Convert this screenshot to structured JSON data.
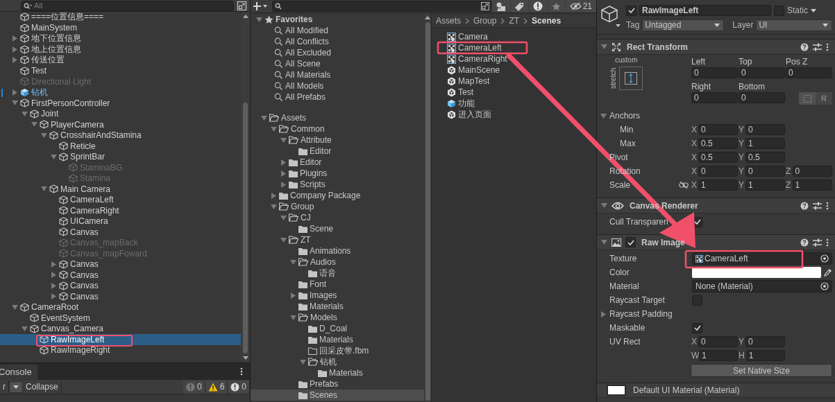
{
  "hierarchy": {
    "search": {
      "placeholder": "All"
    },
    "items": [
      {
        "name": "====位置信息====",
        "kind": "object",
        "active": true,
        "selected": false
      },
      {
        "name": "MainSystem",
        "kind": "object",
        "active": true,
        "selected": false
      },
      {
        "name": "地下位置信息",
        "kind": "object",
        "active": true,
        "selected": false,
        "expanded": false
      },
      {
        "name": "地上位置信息",
        "kind": "object",
        "active": true,
        "selected": false,
        "expanded": false
      },
      {
        "name": "传送位置",
        "kind": "object",
        "active": true,
        "selected": false,
        "expanded": false
      },
      {
        "name": "Test",
        "kind": "object",
        "active": true,
        "selected": false
      },
      {
        "name": "Directional Light",
        "kind": "object",
        "active": false,
        "selected": false
      },
      {
        "name": "钻机",
        "kind": "prefab",
        "active": true,
        "selected": false,
        "expanded": false
      },
      {
        "name": "FirstPersonController",
        "kind": "object",
        "active": true,
        "selected": false,
        "expanded": true,
        "children": [
          {
            "name": "Joint",
            "kind": "object",
            "active": true,
            "selected": false,
            "expanded": true,
            "children": [
              {
                "name": "PlayerCamera",
                "kind": "object",
                "active": true,
                "selected": false,
                "expanded": true,
                "children": [
                  {
                    "name": "CrosshairAndStamina",
                    "kind": "object",
                    "active": true,
                    "selected": false,
                    "expanded": true,
                    "children": [
                      {
                        "name": "Reticle",
                        "kind": "object",
                        "active": true,
                        "selected": false
                      },
                      {
                        "name": "SprintBar",
                        "kind": "object",
                        "active": true,
                        "selected": false,
                        "expanded": true,
                        "children": [
                          {
                            "name": "StaminaBG",
                            "kind": "object",
                            "active": false,
                            "selected": false
                          },
                          {
                            "name": "Stamina",
                            "kind": "object",
                            "active": false,
                            "selected": false
                          }
                        ]
                      }
                    ]
                  },
                  {
                    "name": "Main Camera",
                    "kind": "object",
                    "active": true,
                    "selected": false,
                    "expanded": true,
                    "children": [
                      {
                        "name": "CameraLeft",
                        "kind": "object",
                        "active": true,
                        "selected": false
                      },
                      {
                        "name": "CameraRight",
                        "kind": "object",
                        "active": true,
                        "selected": false
                      },
                      {
                        "name": "UICamera",
                        "kind": "object",
                        "active": true,
                        "selected": false
                      },
                      {
                        "name": "Canvas",
                        "kind": "object",
                        "active": true,
                        "selected": false
                      },
                      {
                        "name": "Canvas_mapBack",
                        "kind": "object",
                        "active": false,
                        "selected": false
                      },
                      {
                        "name": "Canvas_mapFoward",
                        "kind": "object",
                        "active": false,
                        "selected": false
                      },
                      {
                        "name": "Canvas",
                        "kind": "object",
                        "active": true,
                        "selected": false,
                        "expanded": false
                      },
                      {
                        "name": "Canvas",
                        "kind": "object",
                        "active": true,
                        "selected": false,
                        "expanded": false
                      },
                      {
                        "name": "Canvas",
                        "kind": "object",
                        "active": true,
                        "selected": false,
                        "expanded": false
                      },
                      {
                        "name": "Canvas",
                        "kind": "object",
                        "active": true,
                        "selected": false,
                        "expanded": false
                      }
                    ]
                  }
                ]
              }
            ]
          }
        ]
      },
      {
        "name": "CameraRoot",
        "kind": "object",
        "active": true,
        "selected": false,
        "expanded": true,
        "children": [
          {
            "name": "EventSystem",
            "kind": "object",
            "active": true,
            "selected": false
          },
          {
            "name": "Canvas_Camera",
            "kind": "object",
            "active": true,
            "selected": false,
            "expanded": true,
            "children": [
              {
                "name": "RawImageLeft",
                "kind": "object",
                "active": true,
                "selected": true
              },
              {
                "name": "RawImageRight",
                "kind": "object",
                "active": true,
                "selected": false
              }
            ]
          }
        ]
      }
    ]
  },
  "console": {
    "tab": "Console",
    "clear_tail": "r",
    "collapse": "Collapse",
    "infos": "0",
    "warnings": "6",
    "errors": "0"
  },
  "project": {
    "hidden_count": "21",
    "favorites": {
      "label": "Favorites",
      "expanded": true,
      "items": [
        "All Modified",
        "All Conflicts",
        "All Excluded",
        "All Scene",
        "All Materials",
        "All Models",
        "All Prefabs"
      ]
    },
    "tree": [
      {
        "name": "Assets",
        "selected": false,
        "expanded": true,
        "children": [
          {
            "name": "Common",
            "selected": false,
            "expanded": true,
            "children": [
              {
                "name": "Attribute",
                "selected": false,
                "expanded": true,
                "children": [
                  {
                    "name": "Editor",
                    "selected": false
                  }
                ]
              },
              {
                "name": "Editor",
                "selected": false,
                "expanded": false
              },
              {
                "name": "Plugins",
                "selected": false,
                "expanded": false
              },
              {
                "name": "Scripts",
                "selected": false,
                "expanded": false
              }
            ]
          },
          {
            "name": "Company Package",
            "selected": false,
            "expanded": false
          },
          {
            "name": "Group",
            "selected": false,
            "expanded": true,
            "children": [
              {
                "name": "CJ",
                "selected": false,
                "expanded": true,
                "children": [
                  {
                    "name": "Scene",
                    "selected": false
                  }
                ]
              },
              {
                "name": "ZT",
                "selected": false,
                "expanded": true,
                "children": [
                  {
                    "name": "Animations",
                    "selected": false
                  },
                  {
                    "name": "Audios",
                    "selected": false,
                    "expanded": true,
                    "children": [
                      {
                        "name": "语音",
                        "selected": false
                      }
                    ]
                  },
                  {
                    "name": "Font",
                    "selected": false
                  },
                  {
                    "name": "Images",
                    "selected": false,
                    "expanded": false
                  },
                  {
                    "name": "Materials",
                    "selected": false
                  },
                  {
                    "name": "Models",
                    "selected": false,
                    "expanded": true,
                    "children": [
                      {
                        "name": "D_Coal",
                        "selected": false
                      },
                      {
                        "name": "Materials",
                        "selected": false
                      },
                      {
                        "name": "回采皮带.fbm",
                        "selected": false,
                        "empty": true
                      },
                      {
                        "name": "钻机",
                        "selected": false,
                        "expanded": true,
                        "children": [
                          {
                            "name": "Materials",
                            "selected": false
                          }
                        ]
                      }
                    ]
                  },
                  {
                    "name": "Prefabs",
                    "selected": false
                  },
                  {
                    "name": "Scenes",
                    "selected": true
                  }
                ]
              }
            ]
          }
        ]
      }
    ],
    "breadcrumb": [
      "Assets",
      "Group",
      "ZT",
      "Scenes"
    ],
    "files": [
      {
        "name": "Camera",
        "kind": "render_texture"
      },
      {
        "name": "CameraLeft",
        "kind": "render_texture"
      },
      {
        "name": "CameraRight",
        "kind": "render_texture"
      },
      {
        "name": "MainScene",
        "kind": "scene"
      },
      {
        "name": "MapTest",
        "kind": "scene"
      },
      {
        "name": "Test",
        "kind": "scene"
      },
      {
        "name": "功能",
        "kind": "prefab"
      },
      {
        "name": "进入页面",
        "kind": "scene"
      }
    ]
  },
  "inspector": {
    "active": true,
    "name": "RawImageLeft",
    "static": false,
    "static_label": "Static",
    "tag_label": "Tag",
    "tag": "Untagged",
    "layer_label": "Layer",
    "layer": "UI",
    "components": [
      {
        "kind": "rect_transform",
        "title": "Rect Transform",
        "expanded": true,
        "preset": "custom",
        "preset_axis": "stretch",
        "fields": [
          {
            "label": "Left",
            "value": "0"
          },
          {
            "label": "Top",
            "value": "0"
          },
          {
            "label": "Pos Z",
            "value": "0"
          },
          {
            "label": "Right",
            "value": "0"
          },
          {
            "label": "Bottom",
            "value": "0"
          }
        ],
        "raw_edit_button": "R",
        "rows": [
          {
            "kind": "foldout",
            "label": "Anchors",
            "expanded": true,
            "children": [
              {
                "kind": "vector",
                "label": "Min",
                "axes": [
                  {
                    "axis": "X",
                    "value": "0"
                  },
                  {
                    "axis": "Y",
                    "value": "0"
                  }
                ]
              },
              {
                "kind": "vector",
                "label": "Max",
                "axes": [
                  {
                    "axis": "X",
                    "value": "0.5"
                  },
                  {
                    "axis": "Y",
                    "value": "1"
                  }
                ]
              }
            ]
          },
          {
            "kind": "vector",
            "label": "Pivot",
            "axes": [
              {
                "axis": "X",
                "value": "0.5"
              },
              {
                "axis": "Y",
                "value": "0.5"
              }
            ]
          },
          {
            "kind": "vector",
            "label": "Rotation",
            "axes": [
              {
                "axis": "X",
                "value": "0"
              },
              {
                "axis": "Y",
                "value": "0"
              },
              {
                "axis": "Z",
                "value": "0"
              }
            ]
          },
          {
            "kind": "vector",
            "label": "Scale",
            "linked": false,
            "axes": [
              {
                "axis": "X",
                "value": "1"
              },
              {
                "axis": "Y",
                "value": "1"
              },
              {
                "axis": "Z",
                "value": "1"
              }
            ]
          }
        ]
      },
      {
        "kind": "canvas_renderer",
        "title": "Canvas Renderer",
        "expanded": true,
        "rows": [
          {
            "kind": "toggle",
            "label": "Cull Transparen",
            "checked": true
          }
        ]
      },
      {
        "kind": "raw_image",
        "title": "Raw Image",
        "expanded": true,
        "enabled": true,
        "rows": [
          {
            "kind": "texture_object",
            "label": "Texture",
            "value": "CameraLeft"
          },
          {
            "kind": "color",
            "label": "Color",
            "color": "#ffffff"
          },
          {
            "kind": "object",
            "label": "Material",
            "value": "None (Material)"
          },
          {
            "kind": "toggle",
            "label": "Raycast Target",
            "checked": false
          },
          {
            "kind": "foldout",
            "label": "Raycast Padding",
            "expanded": false
          },
          {
            "kind": "toggle",
            "label": "Maskable",
            "checked": true
          },
          {
            "kind": "vector",
            "label": "UV Rect",
            "axes": [
              {
                "axis": "X",
                "value": "0"
              },
              {
                "axis": "Y",
                "value": "0"
              }
            ]
          },
          {
            "kind": "vector",
            "axes": [
              {
                "axis": "W",
                "value": "1"
              },
              {
                "axis": "H",
                "value": "1"
              }
            ]
          },
          {
            "kind": "button",
            "label": "Set Native Size"
          }
        ]
      },
      {
        "kind": "material",
        "title": "Default UI Material (Material)"
      }
    ]
  }
}
